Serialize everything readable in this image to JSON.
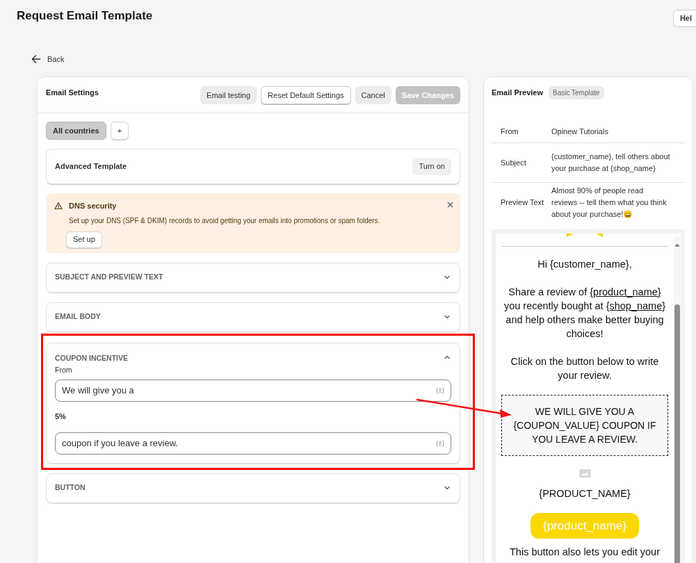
{
  "page_title": "Request Email Template",
  "help_button": "Hel",
  "back_link": "Back",
  "settings": {
    "title": "Email Settings",
    "buttons": [
      {
        "label": "Email testing",
        "kind": "secondary"
      },
      {
        "label": "Reset Default Settings",
        "kind": "outline"
      },
      {
        "label": "Cancel",
        "kind": "secondary"
      },
      {
        "label": "Save Changes",
        "kind": "disabled"
      }
    ],
    "country_tabs": [
      {
        "label": "All countries",
        "selected": true
      },
      {
        "label": "+",
        "selected": false
      }
    ],
    "advanced": {
      "title": "Advanced Template",
      "button": "Turn on"
    },
    "alert": {
      "title": "DNS security",
      "message": "Set up your DNS (SPF & DKIM) records to avoid getting your emails into promotions or spam folders.",
      "button": "Set up"
    },
    "sections": [
      {
        "title": "SUBJECT AND PREVIEW TEXT",
        "expanded": false
      },
      {
        "title": "EMAIL BODY",
        "expanded": false
      },
      {
        "title": "COUPON INCENTIVE",
        "expanded": true,
        "highlighted": true,
        "items": [
          {
            "kind": "label",
            "text": "From"
          },
          {
            "kind": "input",
            "text": "We will give you a"
          },
          {
            "kind": "value",
            "text": "5%"
          },
          {
            "kind": "input",
            "text": "coupon if you leave a review."
          }
        ]
      },
      {
        "title": "BUTTON",
        "expanded": false
      }
    ]
  },
  "preview": {
    "title": "Email Preview",
    "badge": "Basic Template",
    "rows": [
      {
        "label": "From",
        "value": "Opinew Tutorials"
      },
      {
        "label": "Subject",
        "value": "{customer_name}, tell others about your purchase at {shop_name}"
      },
      {
        "label": "Preview Text",
        "value": "Almost 90% of people read reviews -- tell them what you think about your purchase!😄"
      }
    ],
    "email": {
      "greeting": "Hi {customer_name},",
      "paragraph": [
        {
          "text": "Share a review of ",
          "link": false
        },
        {
          "text": "{product_name}",
          "link": true
        },
        {
          "text": " you recently bought at ",
          "link": false
        },
        {
          "text": "{shop_name}",
          "link": true
        },
        {
          "text": " and help others make better buying choices!",
          "link": false
        }
      ],
      "instruction": "Click on the button below to write your review.",
      "coupon": "WE WILL GIVE YOU A {COUPON_VALUE} COUPON IF YOU LEAVE A REVIEW.",
      "product_title": "{PRODUCT_NAME}",
      "cta_button": "{product_name}",
      "footer": "This button also lets you edit your"
    }
  }
}
